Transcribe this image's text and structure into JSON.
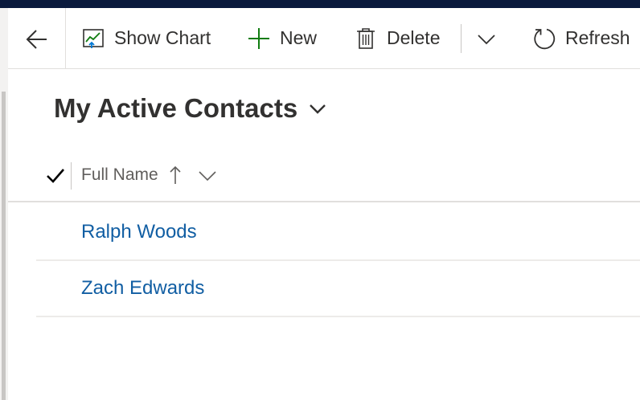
{
  "commands": {
    "show_chart": "Show Chart",
    "new": "New",
    "delete": "Delete",
    "refresh": "Refresh",
    "icons": {
      "back": "back-arrow-icon",
      "show_chart": "chart-icon",
      "new": "plus-icon",
      "delete": "trash-icon",
      "more": "chevron-down-icon",
      "refresh": "refresh-icon"
    }
  },
  "view": {
    "title": "My Active Contacts",
    "selector_icon": "chevron-down-icon"
  },
  "grid": {
    "columns": [
      {
        "label": "Full Name",
        "sort": "ascending"
      }
    ],
    "rows": [
      {
        "full_name": "Ralph Woods"
      },
      {
        "full_name": "Zach Edwards"
      }
    ]
  },
  "colors": {
    "top_bar": "#0a1a3d",
    "link": "#115ea3",
    "new_icon": "#107c10",
    "text": "#323130",
    "muted": "#605e5c"
  }
}
